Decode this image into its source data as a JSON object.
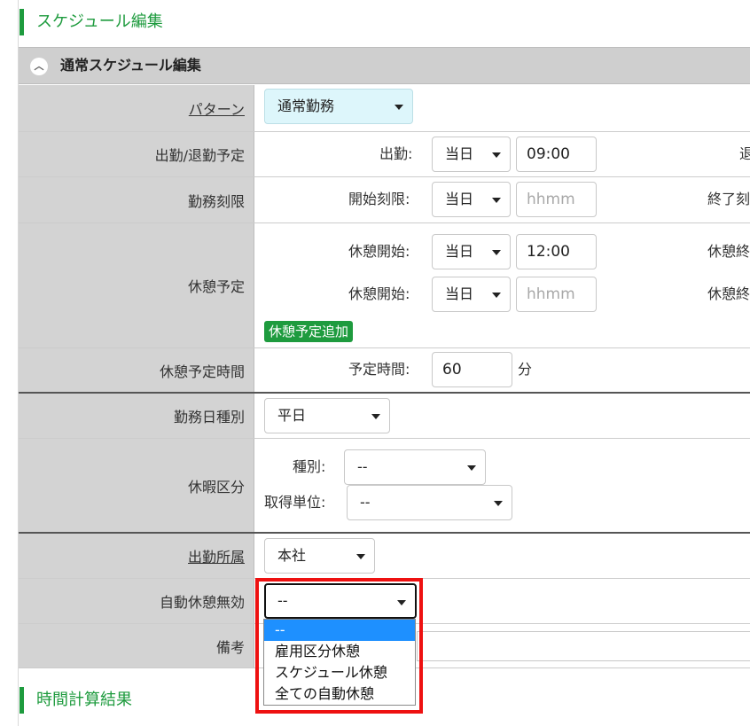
{
  "section_top": {
    "title": "スケジュール編集"
  },
  "panel": {
    "title": "通常スケジュール編集",
    "collapse_icon": "chevron-up-icon"
  },
  "rows": {
    "pattern": {
      "label": "パターン",
      "value": "通常勤務"
    },
    "attendance": {
      "label": "出勤/退勤予定",
      "start_label": "出勤:",
      "start_day": "当日",
      "start_time": "09:00",
      "end_label": "退"
    },
    "work_limit": {
      "label": "勤務刻限",
      "start_label": "開始刻限:",
      "start_day": "当日",
      "start_placeholder": "hhmm",
      "end_label": "終了刻"
    },
    "break_plan": {
      "label": "休憩予定",
      "row1": {
        "start_label": "休憩開始:",
        "day": "当日",
        "time": "12:00",
        "end_label": "休憩終"
      },
      "row2": {
        "start_label": "休憩開始:",
        "day": "当日",
        "time_placeholder": "hhmm",
        "end_label": "休憩終"
      },
      "add_button": "休憩予定追加"
    },
    "break_time": {
      "label": "休憩予定時間",
      "sub_label": "予定時間:",
      "value": "60",
      "unit": "分"
    },
    "day_type": {
      "label": "勤務日種別",
      "value": "平日"
    },
    "leave": {
      "label": "休暇区分",
      "type_label": "種別:",
      "type_value": "--",
      "unit_label": "取得単位:",
      "unit_value": "--"
    },
    "office": {
      "label": "出勤所属",
      "value": "本社"
    },
    "auto_break": {
      "label": "自動休憩無効",
      "value": "--"
    },
    "remarks": {
      "label": "備考"
    }
  },
  "auto_break_options": [
    "--",
    "雇用区分休憩",
    "スケジュール休憩",
    "全ての自動休憩"
  ],
  "auto_break_selected_index": 0,
  "section_bottom": {
    "title": "時間計算結果"
  },
  "colors": {
    "accent_green": "#1e9b3e",
    "highlight_red": "#ee1111",
    "selected_blue": "#1e90ff"
  }
}
